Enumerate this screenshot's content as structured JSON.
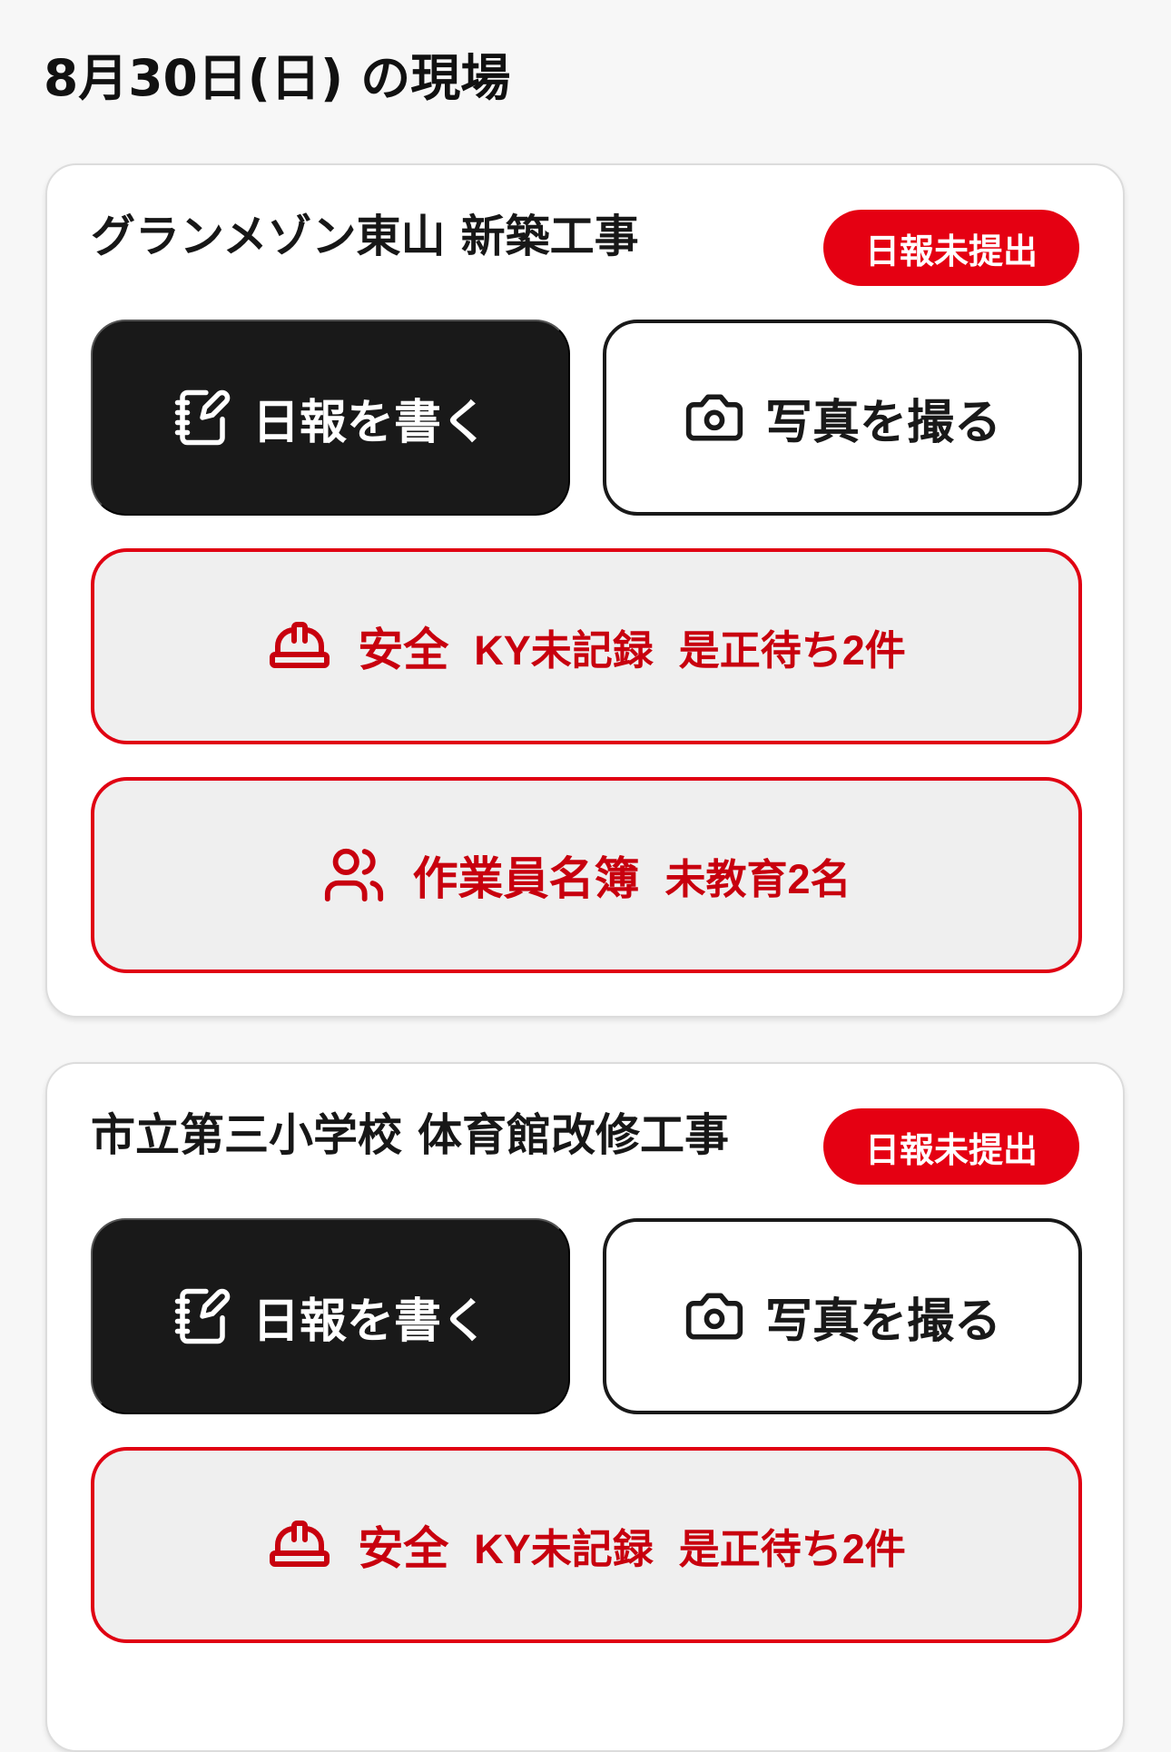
{
  "header": {
    "title": "8月30日(日) の現場"
  },
  "sites": [
    {
      "name": "グランメゾン東山 新築工事",
      "status": "日報未提出",
      "report_button": "日報を書く",
      "photo_button": "写真を撮る",
      "safety": {
        "label": "安全",
        "ky_status": "KY未記録",
        "corrections": "是正待ち2件"
      },
      "roster": {
        "label": "作業員名簿",
        "uneducated": "未教育2名"
      }
    },
    {
      "name": "市立第三小学校 体育館改修工事",
      "status": "日報未提出",
      "report_button": "日報を書く",
      "photo_button": "写真を撮る",
      "safety": {
        "label": "安全",
        "ky_status": "KY未記録",
        "corrections": "是正待ち2件"
      }
    }
  ],
  "icons": {
    "report": "notebook-pen-icon",
    "photo": "camera-icon",
    "safety": "hard-hat-icon",
    "roster": "users-icon"
  },
  "colors": {
    "background": "#f7f7f7",
    "card": "#ffffff",
    "primary_dark": "#191919",
    "alert_red": "#e50012",
    "alert_text_red": "#c8000e"
  }
}
